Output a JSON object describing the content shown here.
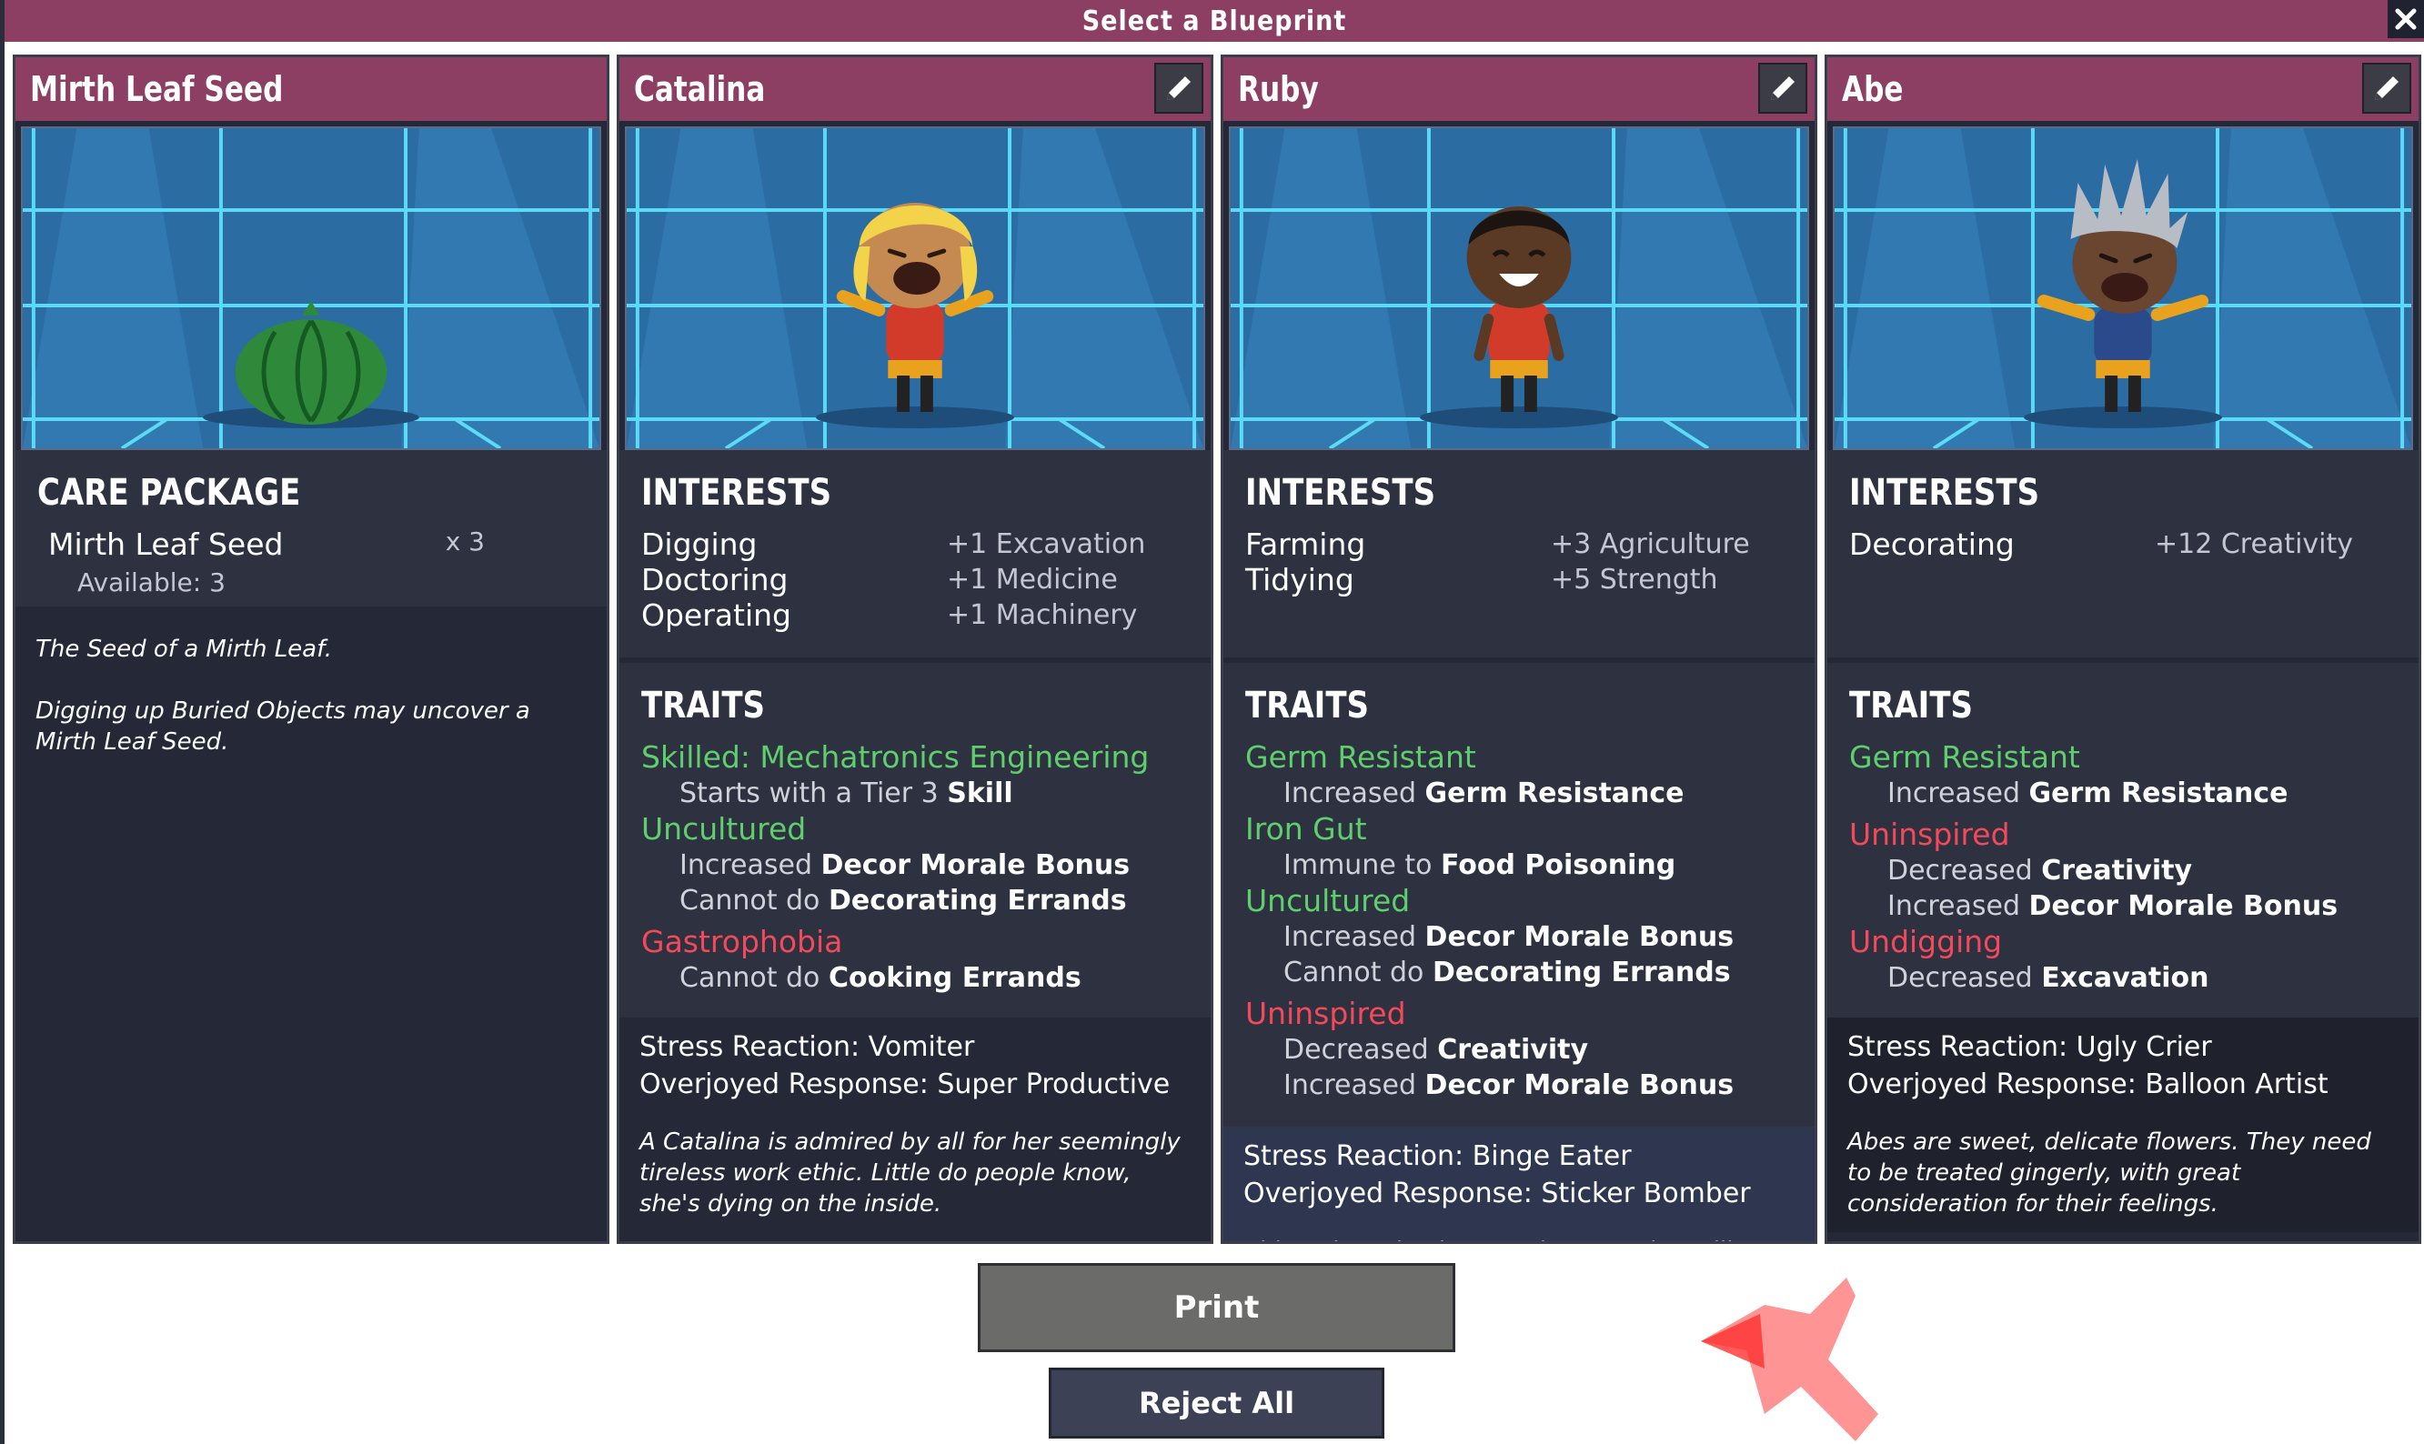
{
  "window": {
    "title": "Select a Blueprint",
    "close_icon": "close-icon"
  },
  "cards": [
    {
      "name": "Mirth Leaf Seed",
      "type": "care-package",
      "section_title": "CARE PACKAGE",
      "item_name": "Mirth Leaf Seed",
      "quantity": "x 3",
      "available": "Available: 3",
      "description_1": "The Seed of a Mirth Leaf.",
      "description_2": "Digging up Buried Objects may uncover a Mirth Leaf Seed."
    },
    {
      "name": "Catalina",
      "interests_title": "INTERESTS",
      "interests": [
        {
          "name": "Digging",
          "bonus": "+1 Excavation"
        },
        {
          "name": "Doctoring",
          "bonus": "+1 Medicine"
        },
        {
          "name": "Operating",
          "bonus": "+1 Machinery"
        }
      ],
      "traits_title": "TRAITS",
      "traits": [
        {
          "name": "Skilled: Mechatronics Engineering",
          "kind": "good",
          "lines": [
            [
              "Starts with a Tier 3 ",
              "Skill"
            ]
          ]
        },
        {
          "name": "Uncultured",
          "kind": "good",
          "lines": [
            [
              "Increased ",
              "Decor Morale Bonus"
            ],
            [
              "Cannot do ",
              "Decorating Errands"
            ]
          ]
        },
        {
          "name": "Gastrophobia",
          "kind": "bad",
          "lines": [
            [
              "Cannot do ",
              "Cooking Errands"
            ]
          ]
        }
      ],
      "stress_reaction": "Stress Reaction: Vomiter",
      "overjoyed_response": "Overjoyed Response: Super Productive",
      "flavor": "A Catalina is admired by all for her seemingly tireless work ethic. Little do people know, she's dying on the inside."
    },
    {
      "name": "Ruby",
      "interests_title": "INTERESTS",
      "interests": [
        {
          "name": "Farming",
          "bonus": "+3 Agriculture"
        },
        {
          "name": "Tidying",
          "bonus": "+5 Strength"
        }
      ],
      "traits_title": "TRAITS",
      "traits": [
        {
          "name": "Germ Resistant",
          "kind": "good",
          "lines": [
            [
              "Increased ",
              "Germ Resistance"
            ]
          ]
        },
        {
          "name": "Iron Gut",
          "kind": "good",
          "lines": [
            [
              "Immune to ",
              "Food Poisoning"
            ]
          ]
        },
        {
          "name": "Uncultured",
          "kind": "good",
          "lines": [
            [
              "Increased ",
              "Decor Morale Bonus"
            ],
            [
              "Cannot do ",
              "Decorating Errands"
            ]
          ]
        },
        {
          "name": "Uninspired",
          "kind": "bad",
          "lines": [
            [
              "Decreased ",
              "Creativity"
            ],
            [
              "Increased ",
              "Decor Morale Bonus"
            ]
          ]
        }
      ],
      "stress_reaction": "Stress Reaction: Binge Eater",
      "overjoyed_response": "Overjoyed Response: Sticker Bomber",
      "flavor": "This Ruby asks the pressing questions, like \"Where"
    },
    {
      "name": "Abe",
      "interests_title": "INTERESTS",
      "interests": [
        {
          "name": "Decorating",
          "bonus": "+12 Creativity"
        }
      ],
      "traits_title": "TRAITS",
      "traits": [
        {
          "name": "Germ Resistant",
          "kind": "good",
          "lines": [
            [
              "Increased ",
              "Germ Resistance"
            ]
          ]
        },
        {
          "name": "Uninspired",
          "kind": "bad",
          "lines": [
            [
              "Decreased ",
              "Creativity"
            ],
            [
              "Increased ",
              "Decor Morale Bonus"
            ]
          ]
        },
        {
          "name": "Undigging",
          "kind": "bad",
          "lines": [
            [
              "Decreased ",
              "Excavation"
            ]
          ]
        }
      ],
      "stress_reaction": "Stress Reaction: Ugly Crier",
      "overjoyed_response": "Overjoyed Response: Balloon Artist",
      "flavor": "Abes are sweet, delicate flowers. They need to be treated gingerly, with great consideration for their feelings."
    }
  ],
  "buttons": {
    "print": "Print",
    "reject_all": "Reject All"
  },
  "colors": {
    "header": "#8c3f63",
    "card_bg": "#242837",
    "trait_good": "#5fcf6d",
    "trait_bad": "#f24a5a"
  }
}
